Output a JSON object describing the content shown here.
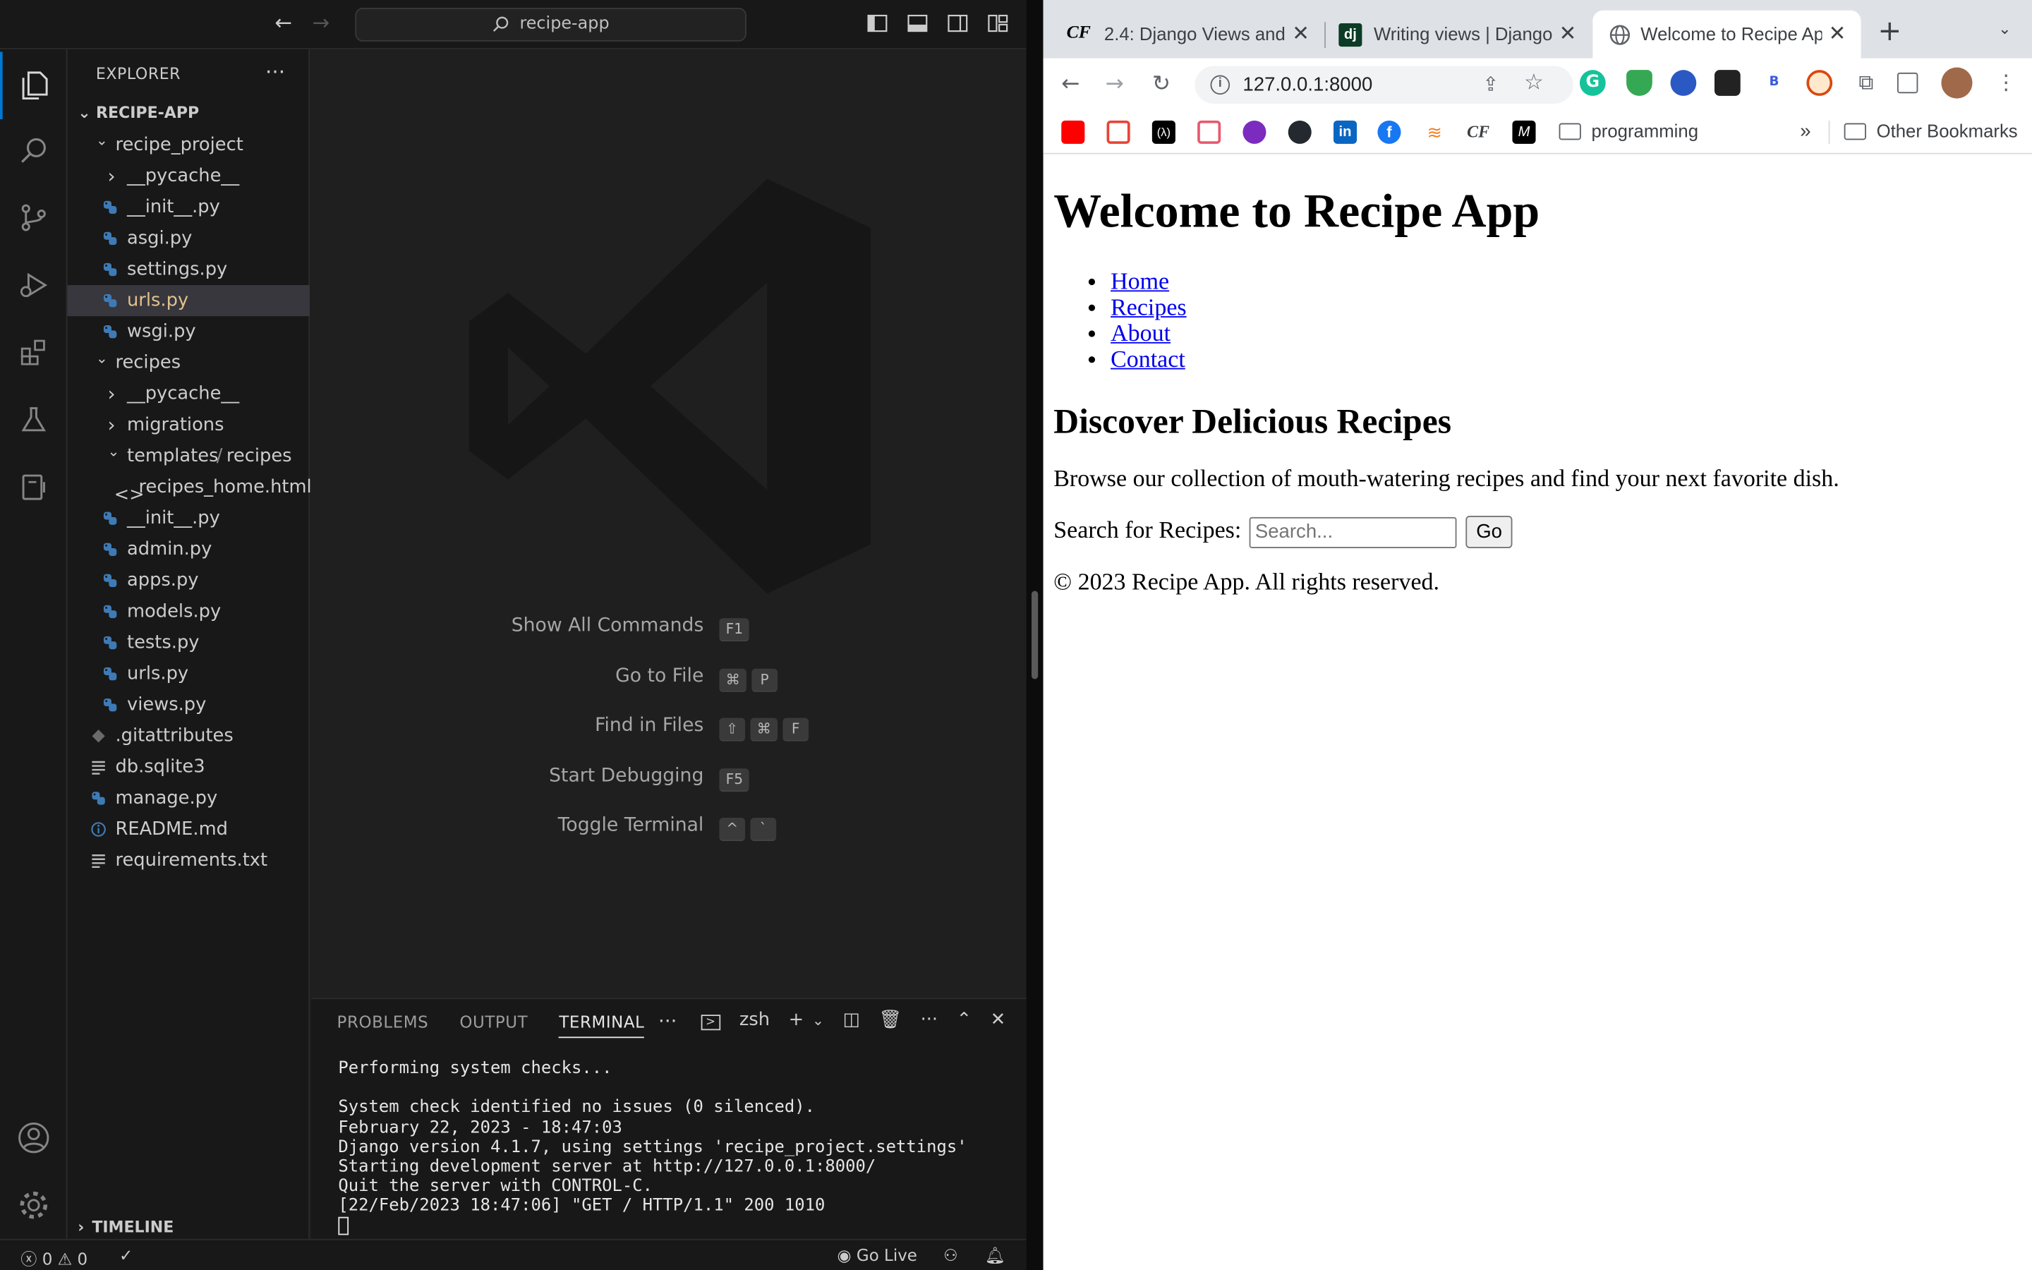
{
  "vscode": {
    "command_center": "recipe-app",
    "explorer": {
      "title": "EXPLORER",
      "root": "RECIPE-APP",
      "tree": [
        {
          "label": "recipe_project",
          "type": "folder-open",
          "depth": 1
        },
        {
          "label": "__pycache__",
          "type": "folder",
          "depth": 2
        },
        {
          "label": "__init__.py",
          "type": "py",
          "depth": 2
        },
        {
          "label": "asgi.py",
          "type": "py",
          "depth": 2
        },
        {
          "label": "settings.py",
          "type": "py",
          "depth": 2
        },
        {
          "label": "urls.py",
          "type": "py",
          "depth": 2,
          "selected": true
        },
        {
          "label": "wsgi.py",
          "type": "py",
          "depth": 2
        },
        {
          "label": "recipes",
          "type": "folder-open",
          "depth": 1
        },
        {
          "label": "__pycache__",
          "type": "folder",
          "depth": 2
        },
        {
          "label": "migrations",
          "type": "folder",
          "depth": 2
        },
        {
          "label": "templates",
          "suffix": "recipes",
          "type": "folder-open",
          "depth": 2
        },
        {
          "label": "recipes_home.html",
          "type": "html",
          "depth": 3
        },
        {
          "label": "__init__.py",
          "type": "py",
          "depth": 2
        },
        {
          "label": "admin.py",
          "type": "py",
          "depth": 2
        },
        {
          "label": "apps.py",
          "type": "py",
          "depth": 2
        },
        {
          "label": "models.py",
          "type": "py",
          "depth": 2
        },
        {
          "label": "tests.py",
          "type": "py",
          "depth": 2
        },
        {
          "label": "urls.py",
          "type": "py",
          "depth": 2
        },
        {
          "label": "views.py",
          "type": "py",
          "depth": 2
        },
        {
          "label": ".gitattributes",
          "type": "git",
          "depth": 1
        },
        {
          "label": "db.sqlite3",
          "type": "text",
          "depth": 1
        },
        {
          "label": "manage.py",
          "type": "py",
          "depth": 1
        },
        {
          "label": "README.md",
          "type": "info",
          "depth": 1
        },
        {
          "label": "requirements.txt",
          "type": "text",
          "depth": 1
        }
      ],
      "timeline": "TIMELINE"
    },
    "shortcuts": [
      {
        "name": "Show All Commands",
        "keys": [
          "F1"
        ]
      },
      {
        "name": "Go to File",
        "keys": [
          "⌘",
          "P"
        ]
      },
      {
        "name": "Find in Files",
        "keys": [
          "⇧",
          "⌘",
          "F"
        ]
      },
      {
        "name": "Start Debugging",
        "keys": [
          "F5"
        ]
      },
      {
        "name": "Toggle Terminal",
        "keys": [
          "^",
          "`"
        ]
      }
    ],
    "panel": {
      "tabs": [
        "PROBLEMS",
        "OUTPUT",
        "TERMINAL"
      ],
      "active_tab": "TERMINAL",
      "shell": "zsh",
      "terminal_lines": [
        "Performing system checks...",
        "",
        "System check identified no issues (0 silenced).",
        "February 22, 2023 - 18:47:03",
        "Django version 4.1.7, using settings 'recipe_project.settings'",
        "Starting development server at http://127.0.0.1:8000/",
        "Quit the server with CONTROL-C.",
        "[22/Feb/2023 18:47:06] \"GET / HTTP/1.1\" 200 1010"
      ]
    },
    "status": {
      "errors": "0",
      "warnings": "0",
      "go_live": "Go Live"
    },
    "colors": {
      "python_icon": "#3e7bb6",
      "html_icon": "#e37933",
      "selected_text": "#e2c08d",
      "accent": "#0078d4"
    }
  },
  "browser": {
    "tabs": [
      {
        "title": "2.4: Django Views and",
        "favicon": "CF"
      },
      {
        "title": "Writing views | Django",
        "favicon": "dj"
      },
      {
        "title": "Welcome to Recipe Ap",
        "favicon": "globe",
        "active": true
      }
    ],
    "url": "127.0.0.1:8000",
    "bookmarks": {
      "folder": "programming",
      "other": "Other Bookmarks",
      "overflow": "»"
    },
    "page": {
      "h1": "Welcome to Recipe App",
      "nav": [
        "Home",
        "Recipes",
        "About",
        "Contact"
      ],
      "h2": "Discover Delicious Recipes",
      "lead": "Browse our collection of mouth-watering recipes and find your next favorite dish.",
      "search_label": "Search for Recipes:",
      "search_placeholder": "Search...",
      "search_button": "Go",
      "footer": "© 2023 Recipe App. All rights reserved."
    }
  }
}
